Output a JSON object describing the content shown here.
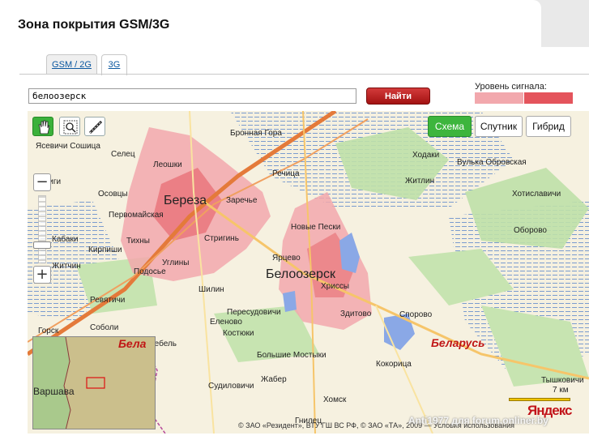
{
  "page": {
    "title": "Зона покрытия GSM/3G"
  },
  "tabs": [
    {
      "label": "GSM / 2G",
      "selected": false
    },
    {
      "label": "3G",
      "selected": true
    }
  ],
  "search": {
    "value": "белоозерск",
    "button_label": "Найти"
  },
  "legend": {
    "label": "Уровень сигнала:",
    "levels": [
      {
        "color": "#f2a8ad"
      },
      {
        "color": "#e4545c"
      }
    ]
  },
  "map": {
    "map_types": [
      {
        "label": "Схема",
        "selected": true
      },
      {
        "label": "Спутник",
        "selected": false
      },
      {
        "label": "Гибрид",
        "selected": false
      }
    ],
    "tools": [
      {
        "icon": "hand-icon",
        "active": true
      },
      {
        "icon": "zoom-rect-icon",
        "active": false
      },
      {
        "icon": "ruler-icon",
        "active": false
      }
    ],
    "zoom_in": "+",
    "zoom_out": "−",
    "places": [
      {
        "name": "Бронная Гора",
        "size": "s"
      },
      {
        "name": "Ясевичи Сошица",
        "size": "s"
      },
      {
        "name": "Селец",
        "size": "s"
      },
      {
        "name": "Леошки",
        "size": "s"
      },
      {
        "name": "Речица",
        "size": "s"
      },
      {
        "name": "Ходаки",
        "size": "s"
      },
      {
        "name": "Вулька Обровская",
        "size": "s"
      },
      {
        "name": "Бусиги",
        "size": "s"
      },
      {
        "name": "Осовцы",
        "size": "s"
      },
      {
        "name": "Береза",
        "size": "b"
      },
      {
        "name": "Заречье",
        "size": "s"
      },
      {
        "name": "Житлин",
        "size": "s"
      },
      {
        "name": "Первомайская",
        "size": "s"
      },
      {
        "name": "Новые Пески",
        "size": "s"
      },
      {
        "name": "Хотиславичи",
        "size": "s"
      },
      {
        "name": "Кабаки",
        "size": "s"
      },
      {
        "name": "Тихны",
        "size": "s"
      },
      {
        "name": "Стригинь",
        "size": "s"
      },
      {
        "name": "Оборово",
        "size": "s"
      },
      {
        "name": "Кирпиши",
        "size": "s"
      },
      {
        "name": "Житчин",
        "size": "s"
      },
      {
        "name": "Углины",
        "size": "s"
      },
      {
        "name": "Ярцево",
        "size": "s"
      },
      {
        "name": "Подосье",
        "size": "s"
      },
      {
        "name": "Белоозерск",
        "size": "b"
      },
      {
        "name": "Хриссы",
        "size": "s"
      },
      {
        "name": "Шилин",
        "size": "s"
      },
      {
        "name": "Ревятичи",
        "size": "s"
      },
      {
        "name": "Пересудовичи",
        "size": "s"
      },
      {
        "name": "Здитово",
        "size": "s"
      },
      {
        "name": "Споровo",
        "size": "s"
      },
      {
        "name": "Еленово",
        "size": "s"
      },
      {
        "name": "Соболи",
        "size": "s"
      },
      {
        "name": "Горск",
        "size": "s"
      },
      {
        "name": "Костюки",
        "size": "s"
      },
      {
        "name": "Вебель",
        "size": "s"
      },
      {
        "name": "Большие Мостыки",
        "size": "s"
      },
      {
        "name": "Кокорица",
        "size": "s"
      },
      {
        "name": "Жабер",
        "size": "s"
      },
      {
        "name": "Судиловичи",
        "size": "s"
      },
      {
        "name": "Тышковичи",
        "size": "s"
      },
      {
        "name": "Хомск",
        "size": "s"
      },
      {
        "name": "Гнилец",
        "size": "s"
      },
      {
        "name": "Варшава",
        "size": "m"
      }
    ],
    "countries": [
      {
        "name": "Беларусь"
      },
      {
        "name": "Бела"
      }
    ],
    "scale_label": "7 км",
    "logo": "Яндекс",
    "copyright": "© ЗАО «Резидент», ВТУ ГШ ВС РФ, © ЗАО «ТА», 2009 — Условия использования",
    "watermark": "Anti1977 для forum.onliner.by"
  }
}
